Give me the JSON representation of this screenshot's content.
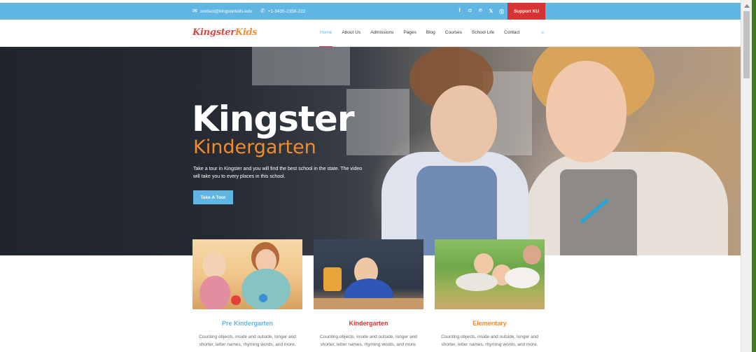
{
  "topbar": {
    "email": "contact@kingsterkids.edu",
    "phone": "+1-3435-2356-222",
    "social_icons": [
      "facebook-icon",
      "instagram-icon",
      "pinterest-icon",
      "x-icon",
      "skype-icon"
    ],
    "support_label": "Support KU",
    "colors": {
      "bar": "#5fb6e3",
      "support": "#d63434"
    }
  },
  "nav": {
    "logo_part1": "Kingster",
    "logo_part2": "Kids",
    "items": [
      {
        "label": "Home",
        "active": true
      },
      {
        "label": "About Us"
      },
      {
        "label": "Admissions"
      },
      {
        "label": "Pages"
      },
      {
        "label": "Blog"
      },
      {
        "label": "Courses"
      },
      {
        "label": "School Life"
      },
      {
        "label": "Contact"
      }
    ],
    "search_icon": "search-icon"
  },
  "hero": {
    "title": "Kingster",
    "subtitle": "Kindergarten",
    "text": "Take a tour in Kingster and you will find the best school in the state. The video will take you to every places in this school.",
    "button_label": "Take A Tour",
    "colors": {
      "subtitle": "#f08c2c",
      "button": "#5fb6e3"
    }
  },
  "cards": [
    {
      "title": "Pre Kindergarten",
      "color": "#5fb6e3",
      "text": "Counting objects, inside and outside, longer and shorter, letter names, rhyming words, and more."
    },
    {
      "title": "Kindergarten",
      "color": "#d63434",
      "text": "Counting objects, inside and outside, longer and shorter, letter names, rhyming words, and more."
    },
    {
      "title": "Elementary",
      "color": "#f08c2c",
      "text": "Counting objects, inside and outside, longer and shorter, letter names, rhyming words, and more."
    }
  ]
}
